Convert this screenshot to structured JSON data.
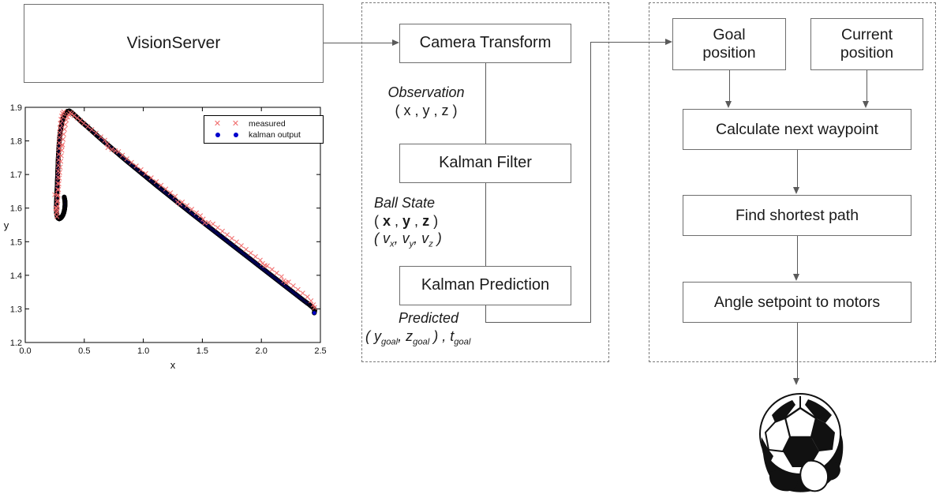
{
  "diagram": {
    "source_box": {
      "label": "VisionServer"
    },
    "panels": {
      "estimation": {
        "name": "estimation-panel"
      },
      "control": {
        "name": "control-panel"
      }
    },
    "estimation_boxes": [
      {
        "label": "Camera Transform",
        "name": "camera-transform-box"
      },
      {
        "label": "Kalman Filter",
        "name": "kalman-filter-box"
      },
      {
        "label": "Kalman Prediction",
        "name": "kalman-prediction-box"
      }
    ],
    "estimation_edges": [
      {
        "title": "Observation",
        "tuple": "( x , y , z )"
      },
      {
        "title": "Ball State",
        "tuple1_a": "( ",
        "tuple1_b": "x",
        "tuple1_c": " , ",
        "tuple1_d": "y",
        "tuple1_e": " , ",
        "tuple1_f": "z",
        "tuple1_g": " )",
        "tuple2": "( v",
        "tuple2_sub1": "x",
        "tuple2_mid1": ", v",
        "tuple2_sub2": "y",
        "tuple2_mid2": ", v",
        "tuple2_sub3": "z",
        "tuple2_end": " )"
      },
      {
        "title": "Predicted",
        "tuple_a": "( y",
        "tuple_sub1": "goal",
        "tuple_b": ", z",
        "tuple_sub2": "goal",
        "tuple_c": " ) , t",
        "tuple_sub3": "goal"
      }
    ],
    "control_boxes": [
      {
        "label": "Goal\nposition",
        "name": "goal-position-box"
      },
      {
        "label": "Current\nposition",
        "name": "current-position-box"
      },
      {
        "label": "Calculate next waypoint",
        "name": "calculate-next-waypoint-box"
      },
      {
        "label": "Find shortest path",
        "name": "find-shortest-path-box"
      },
      {
        "label": "Angle setpoint to motors",
        "name": "angle-setpoint-to-motors-box"
      }
    ],
    "output": {
      "icon": "soccer-ball-icon"
    },
    "colors": {
      "box_border": "#6e6e6e",
      "panel_border": "#7a7a7a",
      "connector": "#5a5a5a"
    }
  },
  "chart_data": {
    "type": "scatter",
    "title": "",
    "xlabel": "x",
    "ylabel": "y",
    "xlim": [
      0.0,
      2.5
    ],
    "ylim": [
      1.2,
      1.9
    ],
    "xticks": [
      "0.0",
      "0.5",
      "1.0",
      "1.5",
      "2.0",
      "2.5"
    ],
    "xtick_values": [
      0.0,
      0.5,
      1.0,
      1.5,
      2.0,
      2.5
    ],
    "yticks": [
      "1.2",
      "1.3",
      "1.4",
      "1.5",
      "1.6",
      "1.7",
      "1.8",
      "1.9"
    ],
    "ytick_values": [
      1.2,
      1.3,
      1.4,
      1.5,
      1.6,
      1.7,
      1.8,
      1.9
    ],
    "grid": false,
    "legend_position": "upper right",
    "legend": [
      {
        "label": "measured",
        "marker": "x",
        "color": "#f06a6a"
      },
      {
        "label": "kalman output",
        "marker": "o",
        "color": "#0000cc"
      }
    ],
    "series": [
      {
        "name": "measured",
        "marker": "x",
        "color": "#f06a6a",
        "points": [
          [
            0.25,
            1.64
          ],
          [
            0.262,
            1.58
          ],
          [
            0.268,
            1.6
          ],
          [
            0.272,
            1.628
          ],
          [
            0.275,
            1.655
          ],
          [
            0.277,
            1.683
          ],
          [
            0.279,
            1.71
          ],
          [
            0.281,
            1.735
          ],
          [
            0.283,
            1.76
          ],
          [
            0.285,
            1.786
          ],
          [
            0.288,
            1.81
          ],
          [
            0.292,
            1.832
          ],
          [
            0.297,
            1.852
          ],
          [
            0.305,
            1.87
          ],
          [
            0.316,
            1.882
          ],
          [
            0.33,
            1.889
          ],
          [
            0.268,
            1.575
          ],
          [
            0.272,
            1.598
          ],
          [
            0.276,
            1.622
          ],
          [
            0.28,
            1.647
          ],
          [
            0.285,
            1.672
          ],
          [
            0.29,
            1.698
          ],
          [
            0.296,
            1.722
          ],
          [
            0.303,
            1.748
          ],
          [
            0.31,
            1.772
          ],
          [
            0.318,
            1.797
          ],
          [
            0.326,
            1.82
          ],
          [
            0.336,
            1.842
          ],
          [
            0.348,
            1.862
          ],
          [
            0.362,
            1.876
          ],
          [
            0.38,
            1.884
          ],
          [
            0.4,
            1.879
          ],
          [
            0.44,
            1.868
          ],
          [
            0.48,
            1.857
          ],
          [
            0.53,
            1.843
          ],
          [
            0.58,
            1.829
          ],
          [
            0.64,
            1.812
          ],
          [
            0.69,
            1.797
          ],
          [
            0.7,
            1.78
          ],
          [
            0.75,
            1.772
          ],
          [
            0.79,
            1.768
          ],
          [
            0.84,
            1.752
          ],
          [
            0.9,
            1.736
          ],
          [
            0.96,
            1.72
          ],
          [
            1.02,
            1.703
          ],
          [
            1.09,
            1.684
          ],
          [
            1.15,
            1.668
          ],
          [
            1.21,
            1.651
          ],
          [
            1.27,
            1.635
          ],
          [
            1.3,
            1.61
          ],
          [
            1.33,
            1.618
          ],
          [
            1.39,
            1.602
          ],
          [
            1.45,
            1.586
          ],
          [
            1.5,
            1.573
          ],
          [
            1.52,
            1.556
          ],
          [
            1.57,
            1.558
          ],
          [
            1.63,
            1.542
          ],
          [
            1.69,
            1.526
          ],
          [
            1.75,
            1.51
          ],
          [
            1.81,
            1.494
          ],
          [
            1.87,
            1.477
          ],
          [
            1.93,
            1.461
          ],
          [
            1.99,
            1.445
          ],
          [
            2.02,
            1.43
          ],
          [
            2.05,
            1.428
          ],
          [
            2.11,
            1.412
          ],
          [
            2.17,
            1.396
          ],
          [
            2.2,
            1.378
          ],
          [
            2.23,
            1.38
          ],
          [
            2.29,
            1.363
          ],
          [
            2.35,
            1.347
          ],
          [
            2.41,
            1.33
          ],
          [
            2.44,
            1.312
          ],
          [
            2.455,
            1.3
          ]
        ]
      },
      {
        "name": "kalman output",
        "marker": "o",
        "color": "#0000cc",
        "points": [
          [
            0.33,
            1.633
          ],
          [
            0.336,
            1.622
          ],
          [
            0.337,
            1.61
          ],
          [
            0.334,
            1.598
          ],
          [
            0.328,
            1.588
          ],
          [
            0.32,
            1.58
          ],
          [
            0.31,
            1.574
          ],
          [
            0.299,
            1.57
          ],
          [
            0.288,
            1.568
          ],
          [
            0.278,
            1.57
          ],
          [
            0.27,
            1.576
          ],
          [
            0.265,
            1.586
          ],
          [
            0.263,
            1.598
          ],
          [
            0.264,
            1.612
          ],
          [
            0.266,
            1.628
          ],
          [
            0.268,
            1.645
          ],
          [
            0.27,
            1.662
          ],
          [
            0.272,
            1.68
          ],
          [
            0.274,
            1.698
          ],
          [
            0.276,
            1.716
          ],
          [
            0.278,
            1.734
          ],
          [
            0.28,
            1.752
          ],
          [
            0.283,
            1.77
          ],
          [
            0.286,
            1.788
          ],
          [
            0.29,
            1.805
          ],
          [
            0.295,
            1.822
          ],
          [
            0.302,
            1.838
          ],
          [
            0.311,
            1.855
          ],
          [
            0.323,
            1.87
          ],
          [
            0.338,
            1.881
          ],
          [
            0.356,
            1.888
          ],
          [
            0.375,
            1.889
          ],
          [
            0.395,
            1.884
          ],
          [
            0.42,
            1.876
          ],
          [
            0.45,
            1.866
          ],
          [
            0.48,
            1.856
          ],
          [
            0.51,
            1.847
          ],
          [
            0.545,
            1.836
          ],
          [
            0.58,
            1.825
          ],
          [
            0.615,
            1.814
          ],
          [
            0.65,
            1.803
          ],
          [
            0.69,
            1.791
          ],
          [
            0.73,
            1.779
          ],
          [
            0.77,
            1.767
          ],
          [
            0.81,
            1.755
          ],
          [
            0.85,
            1.743
          ],
          [
            0.895,
            1.73
          ],
          [
            0.94,
            1.717
          ],
          [
            0.985,
            1.704
          ],
          [
            1.03,
            1.691
          ],
          [
            1.075,
            1.678
          ],
          [
            1.12,
            1.665
          ],
          [
            1.17,
            1.651
          ],
          [
            1.22,
            1.637
          ],
          [
            1.27,
            1.623
          ],
          [
            1.32,
            1.609
          ],
          [
            1.37,
            1.595
          ],
          [
            1.42,
            1.581
          ],
          [
            1.475,
            1.566
          ],
          [
            1.53,
            1.551
          ],
          [
            1.585,
            1.536
          ],
          [
            1.64,
            1.521
          ],
          [
            1.695,
            1.506
          ],
          [
            1.75,
            1.491
          ],
          [
            1.805,
            1.476
          ],
          [
            1.86,
            1.461
          ],
          [
            1.915,
            1.446
          ],
          [
            1.97,
            1.431
          ],
          [
            2.025,
            1.416
          ],
          [
            2.08,
            1.401
          ],
          [
            2.135,
            1.386
          ],
          [
            2.19,
            1.371
          ],
          [
            2.245,
            1.356
          ],
          [
            2.3,
            1.341
          ],
          [
            2.355,
            1.326
          ],
          [
            2.405,
            1.313
          ],
          [
            2.44,
            1.303
          ],
          [
            2.452,
            1.296
          ],
          [
            2.448,
            1.288
          ]
        ]
      }
    ]
  }
}
